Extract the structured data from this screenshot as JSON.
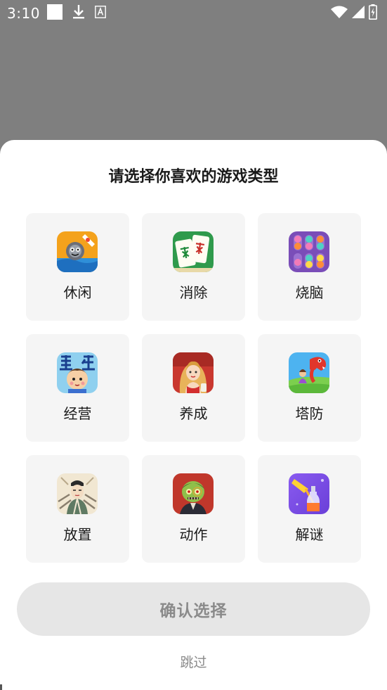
{
  "status_bar": {
    "time": "3:10",
    "icons": [
      "notification-square-icon",
      "download-icon",
      "text-a-icon",
      "wifi-icon",
      "signal-icon",
      "battery-charging-icon"
    ]
  },
  "sheet": {
    "title": "请选择你喜欢的游戏类型",
    "categories": [
      {
        "label": "休闲",
        "icon": "casual-game-icon"
      },
      {
        "label": "消除",
        "icon": "mahjong-match-icon"
      },
      {
        "label": "烧脑",
        "icon": "puzzle-bottles-icon"
      },
      {
        "label": "经营",
        "icon": "business-sim-icon"
      },
      {
        "label": "养成",
        "icon": "character-raising-icon"
      },
      {
        "label": "塔防",
        "icon": "tower-defense-icon"
      },
      {
        "label": "放置",
        "icon": "idle-game-icon"
      },
      {
        "label": "动作",
        "icon": "action-zombie-icon"
      },
      {
        "label": "解谜",
        "icon": "riddle-bottle-icon"
      }
    ],
    "confirm_label": "确认选择",
    "skip_label": "跳过"
  },
  "colors": {
    "backdrop": "#7f7f7f",
    "card_background": "#f5f5f5",
    "button_disabled_bg": "#e6e6e6",
    "button_disabled_text": "#8a8a8a"
  }
}
